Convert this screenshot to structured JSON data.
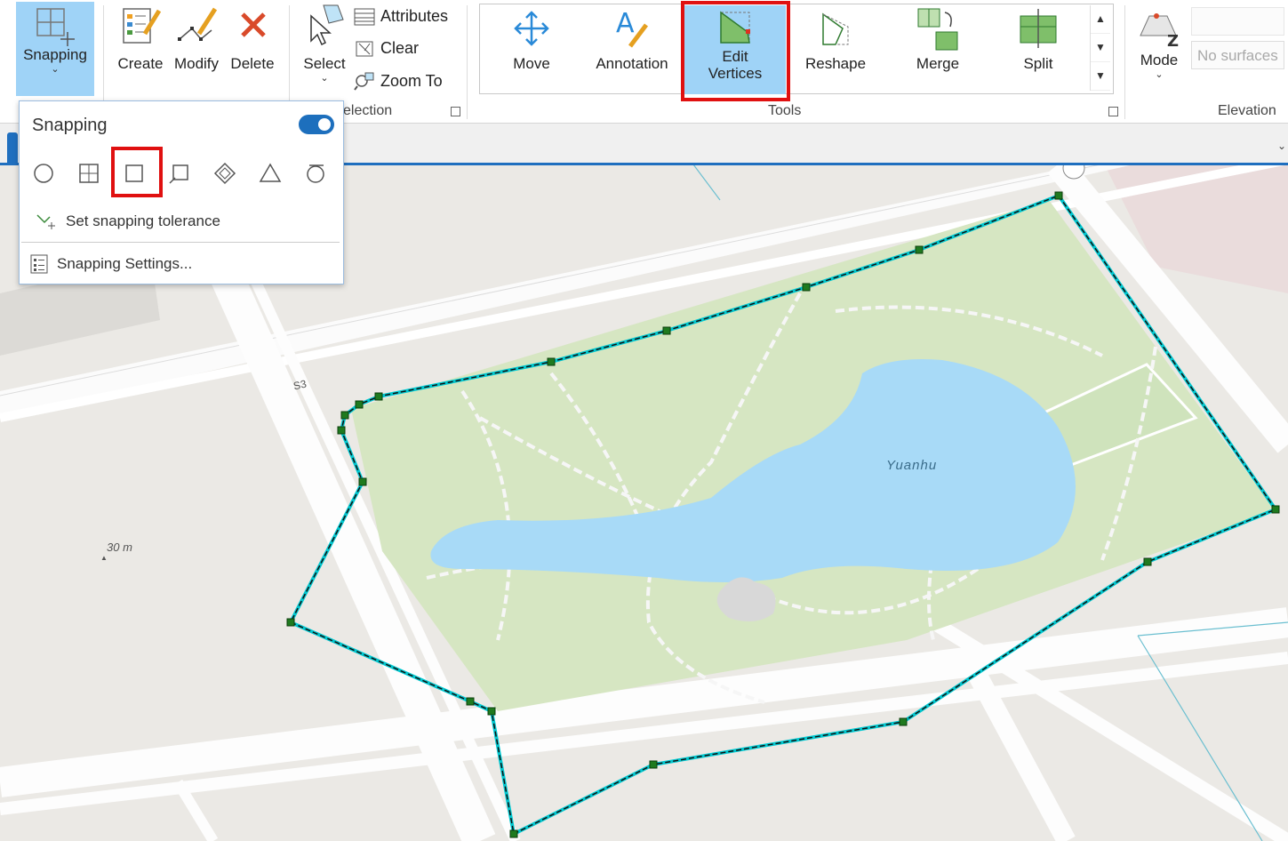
{
  "ribbon": {
    "snapping": {
      "label": "Snapping"
    },
    "features": {
      "create": "Create",
      "modify": "Modify",
      "delete": "Delete"
    },
    "selection": {
      "select": "Select",
      "attributes": "Attributes",
      "clear": "Clear",
      "zoom_to": "Zoom To",
      "group_label": "election"
    },
    "tools": {
      "move": "Move",
      "annotation": "Annotation",
      "edit_vertices_1": "Edit",
      "edit_vertices_2": "Vertices",
      "reshape": "Reshape",
      "merge": "Merge",
      "split": "Split",
      "group_label": "Tools"
    },
    "elevation": {
      "mode": "Mode",
      "surfaces_placeholder": "No surfaces",
      "group_label": "Elevation"
    }
  },
  "snapping_popup": {
    "title": "Snapping",
    "enabled": true,
    "icons": [
      "point-snap-icon",
      "vertex-snap-icon",
      "edge-snap-icon",
      "endpoint-snap-icon",
      "intersection-snap-icon",
      "midpoint-snap-icon",
      "tangent-snap-icon"
    ],
    "tolerance_label": "Set snapping tolerance",
    "settings_label": "Snapping Settings..."
  },
  "map": {
    "road_label": "S3",
    "lake_label": "Yuanhu",
    "elevation_label": "30 m"
  },
  "colors": {
    "accent": "#1d6fbd",
    "highlight": "#e01010",
    "selected_tool_bg": "#9fd3f7",
    "park": "#d6e6c2",
    "water": "#a8daf7",
    "sketch": "#00c8d0",
    "vertex": "#1f7a1f"
  }
}
